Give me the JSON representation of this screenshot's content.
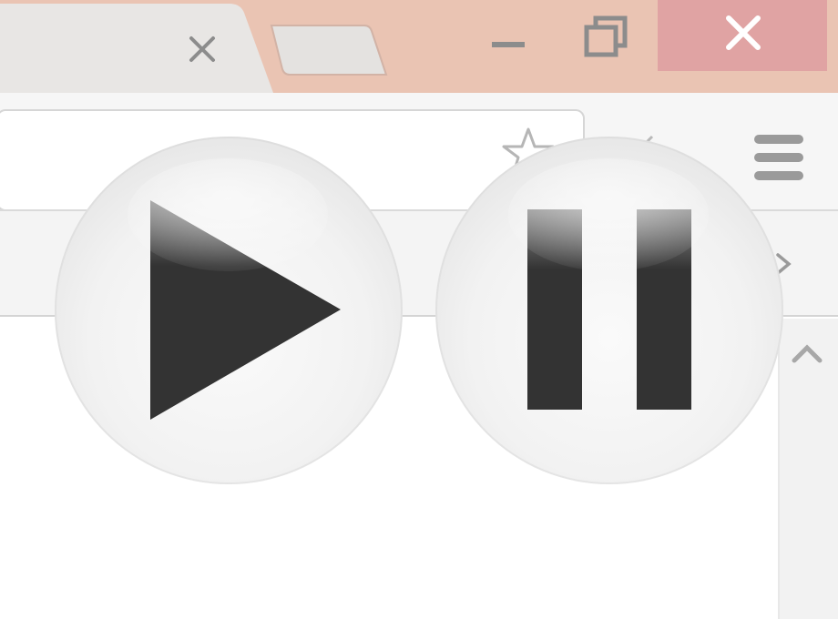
{
  "browser": {
    "tabs": [
      {
        "state": "active",
        "close_icon": "close-icon"
      },
      {
        "state": "new-tab",
        "icon": "new-tab-icon"
      }
    ],
    "window_controls": [
      "minimize-icon",
      "restore-icon",
      "close-icon"
    ],
    "toolbar": {
      "bookmark_icon": "star-icon",
      "menu_icon": "hamburger-menu-icon"
    },
    "colors": {
      "titlebar": "#eac4b3",
      "close_button": "#e0a3a3",
      "toolbar": "#f6f6f6",
      "glyph_dark": "#333333"
    }
  },
  "media_controls": [
    {
      "name": "play",
      "icon": "play-icon"
    },
    {
      "name": "pause",
      "icon": "pause-icon"
    }
  ]
}
